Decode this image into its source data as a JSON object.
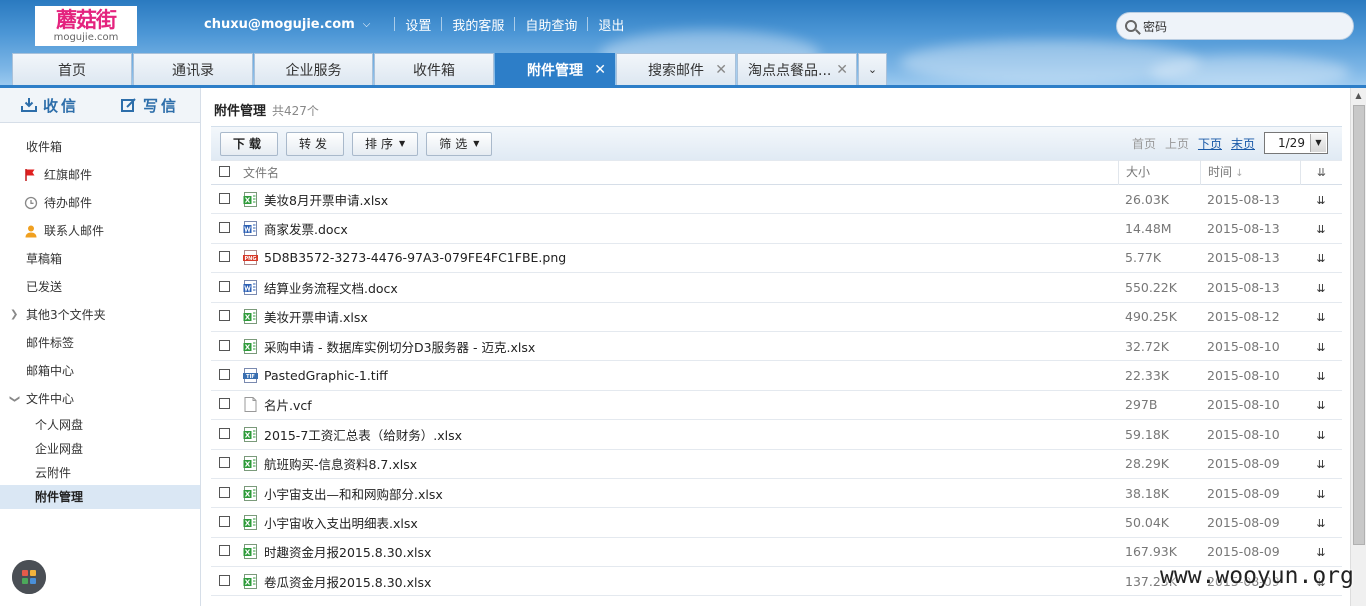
{
  "brand": {
    "name_cn": "蘑菇街",
    "name_en": "mogujie.com"
  },
  "topnav": {
    "email": "chuxu@mogujie.com",
    "links": [
      "设置",
      "我的客服",
      "自助查询",
      "退出"
    ]
  },
  "search": {
    "value": "密码"
  },
  "tabs": [
    {
      "label": "首页"
    },
    {
      "label": "通讯录"
    },
    {
      "label": "企业服务"
    },
    {
      "label": "收件箱"
    },
    {
      "label": "附件管理",
      "active": true,
      "closable": true
    },
    {
      "label": "搜索邮件",
      "closable": true
    },
    {
      "label": "淘点点餐品...",
      "closable": true
    }
  ],
  "sidebar": {
    "compose": {
      "receive": "收信",
      "write": "写信"
    },
    "items": [
      {
        "label": "收件箱"
      },
      {
        "label": "红旗邮件",
        "icon": "red-flag-icon"
      },
      {
        "label": "待办邮件",
        "icon": "clock-icon"
      },
      {
        "label": "联系人邮件",
        "icon": "person-icon"
      },
      {
        "label": "草稿箱"
      },
      {
        "label": "已发送"
      },
      {
        "label": "其他3个文件夹",
        "expander": "collapsed"
      },
      {
        "label": "邮件标签"
      },
      {
        "label": "邮箱中心"
      },
      {
        "label": "文件中心",
        "expander": "expanded"
      }
    ],
    "subitems": [
      {
        "label": "个人网盘"
      },
      {
        "label": "企业网盘"
      },
      {
        "label": "云附件"
      },
      {
        "label": "附件管理",
        "active": true
      }
    ]
  },
  "main": {
    "title": "附件管理",
    "count": "共427个",
    "toolbar": {
      "download": "下载",
      "forward": "转发",
      "sort": "排序",
      "filter": "筛选"
    },
    "pager": {
      "first": "首页",
      "prev": "上页",
      "next": "下页",
      "last": "末页",
      "page": "1/29"
    },
    "columns": {
      "name": "文件名",
      "size": "大小",
      "time": "时间"
    },
    "files": [
      {
        "name": "美妆8月开票申请.xlsx",
        "type": "xlsx",
        "size": "26.03K",
        "time": "2015-08-13"
      },
      {
        "name": "商家发票.docx",
        "type": "docx",
        "size": "14.48M",
        "time": "2015-08-13"
      },
      {
        "name": "5D8B3572-3273-4476-97A3-079FE4FC1FBE.png",
        "type": "png",
        "size": "5.77K",
        "time": "2015-08-13"
      },
      {
        "name": "结算业务流程文档.docx",
        "type": "docx",
        "size": "550.22K",
        "time": "2015-08-13"
      },
      {
        "name": "美妆开票申请.xlsx",
        "type": "xlsx",
        "size": "490.25K",
        "time": "2015-08-12"
      },
      {
        "name": "采购申请 - 数据库实例切分D3服务器 - 迈克.xlsx",
        "type": "xlsx",
        "size": "32.72K",
        "time": "2015-08-10"
      },
      {
        "name": "PastedGraphic-1.tiff",
        "type": "tiff",
        "size": "22.33K",
        "time": "2015-08-10"
      },
      {
        "name": "名片.vcf",
        "type": "vcf",
        "size": "297B",
        "time": "2015-08-10"
      },
      {
        "name": "2015-7工资汇总表（给财务）.xlsx",
        "type": "xlsx",
        "size": "59.18K",
        "time": "2015-08-10"
      },
      {
        "name": "航班购买-信息资料8.7.xlsx",
        "type": "xlsx",
        "size": "28.29K",
        "time": "2015-08-09"
      },
      {
        "name": "小宇宙支出—和和网购部分.xlsx",
        "type": "xlsx",
        "size": "38.18K",
        "time": "2015-08-09"
      },
      {
        "name": "小宇宙收入支出明细表.xlsx",
        "type": "xlsx",
        "size": "50.04K",
        "time": "2015-08-09"
      },
      {
        "name": "时趣资金月报2015.8.30.xlsx",
        "type": "xlsx",
        "size": "167.93K",
        "time": "2015-08-09"
      },
      {
        "name": "卷瓜资金月报2015.8.30.xlsx",
        "type": "xlsx",
        "size": "137.23K",
        "time": "2015-08-09"
      }
    ]
  },
  "watermark": "www.wooyun.org",
  "colors": {
    "accent": "#2d7ec8",
    "xlsx": "#2e9b3a",
    "docx": "#2b5fb4",
    "png": "#d63a2a",
    "tiff": "#3a6fb0",
    "flag": "#e02020",
    "person": "#f0a020"
  }
}
